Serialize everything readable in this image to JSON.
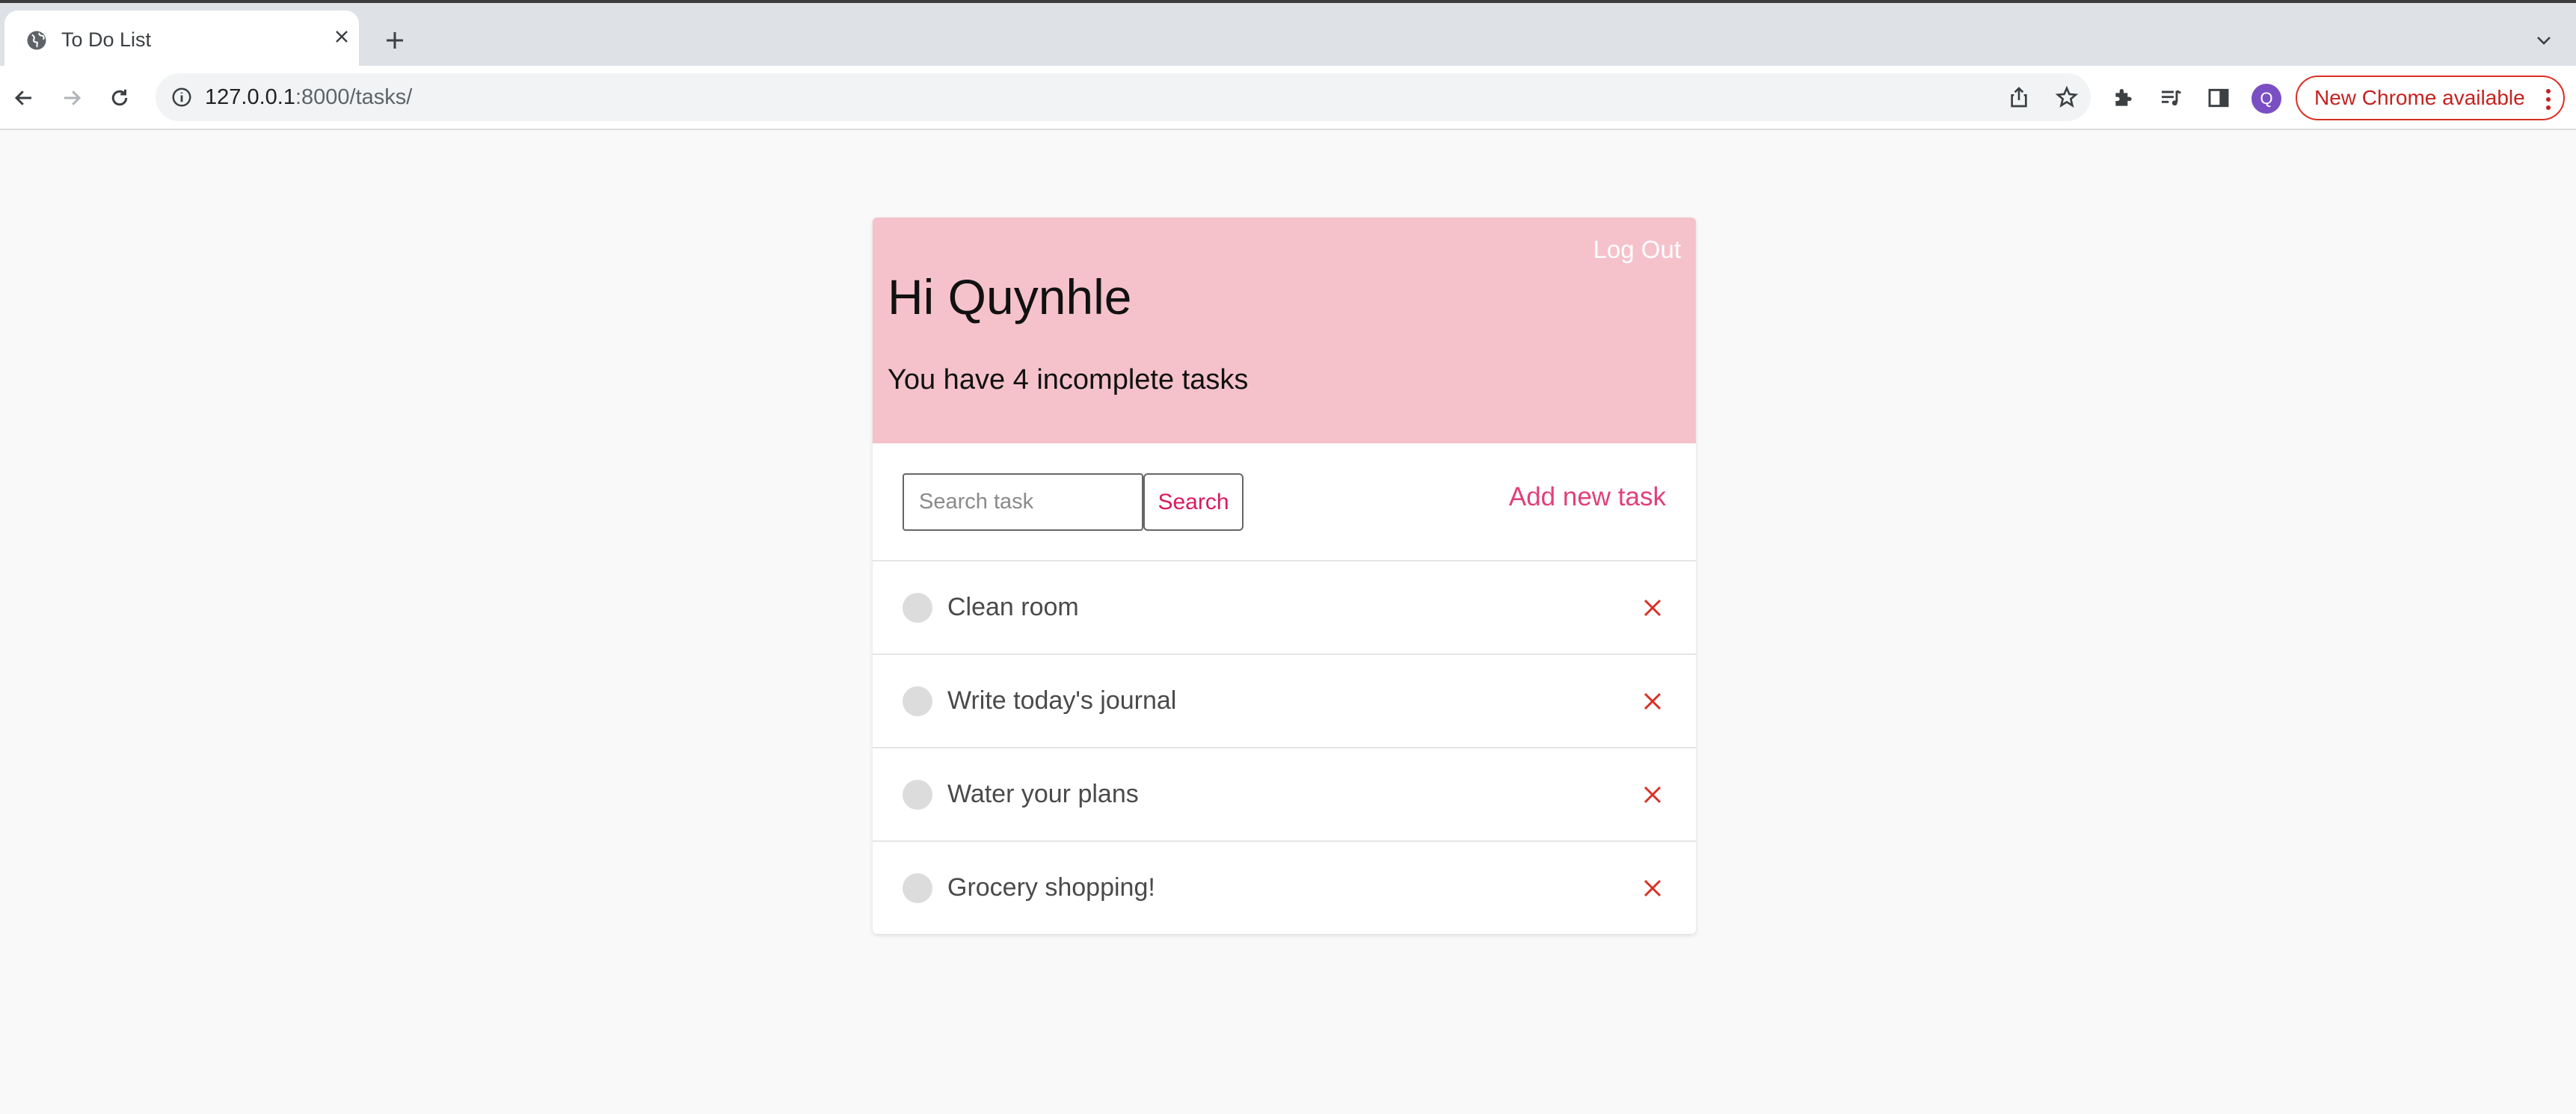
{
  "browser": {
    "tab_title": "To Do List",
    "url_host": "127.0.0.1",
    "url_rest": ":8000/tasks/",
    "profile_initial": "Q",
    "update_label": "New Chrome available",
    "icons": [
      "globe-icon",
      "close-icon",
      "plus-icon",
      "chevron-down-icon",
      "back-arrow-icon",
      "forward-arrow-icon",
      "reload-icon",
      "info-icon",
      "share-icon",
      "star-icon",
      "extensions-icon",
      "media-queue-icon",
      "side-panel-icon",
      "kebab-menu-icon"
    ]
  },
  "header": {
    "logout_label": "Log Out",
    "greeting": "Hi Quynhle",
    "incomplete_text": "You have 4 incomplete tasks"
  },
  "search": {
    "placeholder": "Search task",
    "button_label": "Search",
    "add_label": "Add new task"
  },
  "tasks": [
    {
      "title": "Clean room"
    },
    {
      "title": "Write today's journal"
    },
    {
      "title": "Water your plans"
    },
    {
      "title": "Grocery shopping!"
    }
  ],
  "colors": {
    "header_bg": "#f5c2cb",
    "accent": "#e0407a",
    "delete": "#d93025"
  }
}
